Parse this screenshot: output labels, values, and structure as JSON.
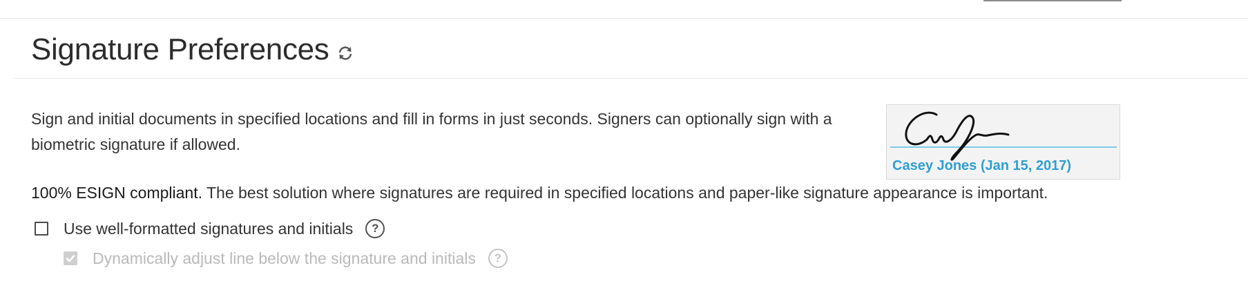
{
  "header": {
    "title": "Signature Preferences",
    "refresh_icon": "refresh-icon"
  },
  "description": {
    "text": "Sign and initial documents in specified locations and fill in forms in just seconds. Signers can optionally sign with a biometric signature if allowed."
  },
  "signature_sample": {
    "caption": "Casey Jones (Jan 15, 2017)",
    "caption_color": "#2f9fd1",
    "line_color": "#7ccbe6"
  },
  "compliance": {
    "bold": "100% ESIGN compliant.",
    "text": " The best solution where signatures are required in specified locations and paper-like signature appearance is important."
  },
  "options": {
    "well_formatted": {
      "label": "Use well-formatted signatures and initials",
      "checked": false,
      "help_icon": "help-icon",
      "help_glyph": "?"
    },
    "dynamic_line": {
      "label": "Dynamically adjust line below the signature and initials",
      "checked": true,
      "disabled": true,
      "help_icon": "help-icon",
      "help_glyph": "?"
    }
  }
}
